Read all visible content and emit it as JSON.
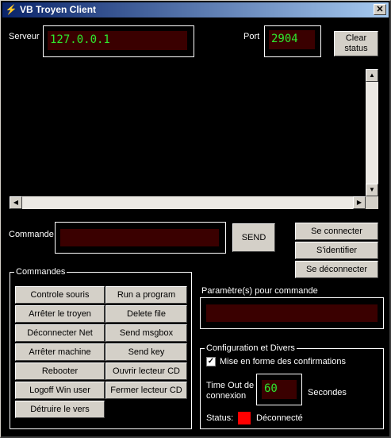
{
  "window": {
    "title": "VB Troyen Client",
    "close_glyph": "✕",
    "app_icon": "⚡"
  },
  "connection": {
    "server_label": "Serveur",
    "server_value": "127.0.0.1",
    "port_label": "Port",
    "port_value": "2904",
    "clear_status_label": "Clear status"
  },
  "command": {
    "label": "Commande",
    "value": "",
    "send_label": "SEND"
  },
  "session_buttons": [
    "Se connecter",
    "S'identifier",
    "Se déconnecter"
  ],
  "commandes": {
    "title": "Commandes",
    "left": [
      "Controle souris",
      "Arrêter le troyen",
      "Déconnecter Net",
      "Arrêter machine",
      "Rebooter",
      "Logoff Win user",
      "Détruire le vers"
    ],
    "right": [
      "Run a program",
      "Delete file",
      "Send msgbox",
      "Send key",
      "Ouvrir lecteur CD",
      "Fermer lecteur CD"
    ]
  },
  "params": {
    "label": "Paramètre(s) pour commande",
    "value": ""
  },
  "config": {
    "title": "Configuration et Divers",
    "confirm_label": "Mise en forme des confirmations",
    "confirm_checked": true,
    "timeout_label": "Time Out de connexion",
    "timeout_value": "60",
    "timeout_unit": "Secondes",
    "status_label": "Status:",
    "status_value": "Déconnecté",
    "status_color": "#ff0000"
  },
  "scrollbar": {
    "up": "▲",
    "down": "▼",
    "left": "◀",
    "right": "▶"
  },
  "colors": {
    "lcd_bg": "#3a0000",
    "lcd_text": "#2ee82e",
    "title_start": "#0a246a",
    "title_end": "#a6caf0"
  }
}
